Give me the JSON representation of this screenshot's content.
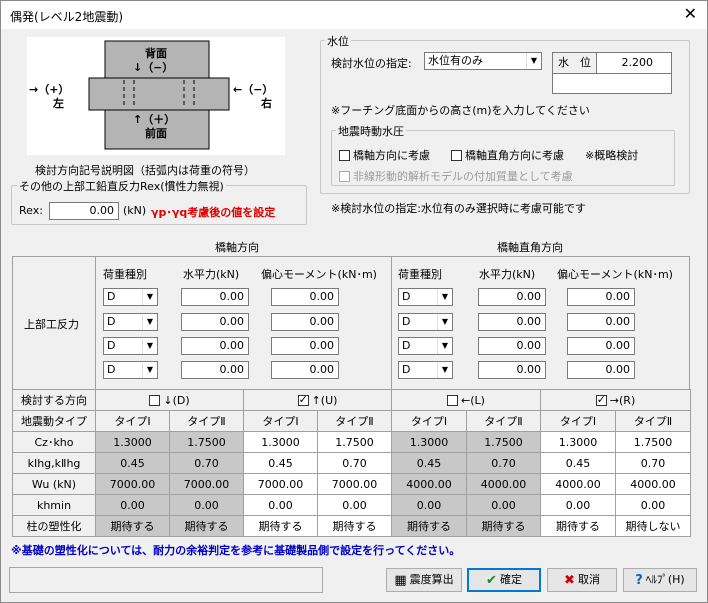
{
  "window": {
    "title": "偶発(レベル2地震動)",
    "close": "✕"
  },
  "diagram": {
    "back_label": "背面",
    "back_sign": "↓（−）",
    "front_label": "前面",
    "front_sign": "↑（＋）",
    "left_sign": "→（+）",
    "left_label": "左",
    "right_sign": "←（−）",
    "right_label": "右",
    "caption": "検討方向記号説明図（括弧内は荷重の符号）"
  },
  "other_reaction": {
    "legend": "その他の上部工鉛直反力Rex(慣性力無視)",
    "label": "Rex:",
    "value": "0.00",
    "unit": "(kN)",
    "note": "γp･γq考慮後の値を設定"
  },
  "water": {
    "legend": "水位",
    "spec_label": "検討水位の指定:",
    "spec_value": "水位有のみ",
    "level_label": "水　位",
    "level_value": "2.200",
    "hint": "※フーチング底面からの高さ(m)を入力してください",
    "pressure": {
      "legend": "地震時動水圧",
      "axis_bridge": "橋軸方向に考慮",
      "axis_perp": "橋軸直角方向に考慮",
      "approx": "※概略検討",
      "nonlinear": "非線形動的解析モデルの付加質量として考慮"
    },
    "footnote": "※検討水位の指定:水位有のみ選択時に考慮可能です"
  },
  "reaction": {
    "title_bridge": "橋軸方向",
    "title_perp": "橋軸直角方向",
    "row_label": "上部工反力",
    "col_type": "荷重種別",
    "col_h": "水平力(kN)",
    "col_m": "偏心モーメント(kN･m)",
    "bridge_rows": [
      {
        "type": "D",
        "h": "0.00",
        "m": "0.00"
      },
      {
        "type": "D",
        "h": "0.00",
        "m": "0.00"
      },
      {
        "type": "D",
        "h": "0.00",
        "m": "0.00"
      },
      {
        "type": "D",
        "h": "0.00",
        "m": "0.00"
      }
    ],
    "perp_rows": [
      {
        "type": "D",
        "h": "0.00",
        "m": "0.00"
      },
      {
        "type": "D",
        "h": "0.00",
        "m": "0.00"
      },
      {
        "type": "D",
        "h": "0.00",
        "m": "0.00"
      },
      {
        "type": "D",
        "h": "0.00",
        "m": "0.00"
      }
    ]
  },
  "directions": {
    "label": "検討する方向",
    "items": [
      {
        "label": "↓(D)",
        "checked": false
      },
      {
        "label": "↑(U)",
        "checked": true
      },
      {
        "label": "←(L)",
        "checked": false
      },
      {
        "label": "→(R)",
        "checked": true
      }
    ]
  },
  "params": {
    "type_label": "地震動タイプ",
    "types": [
      "タイプⅠ",
      "タイプⅡ",
      "タイプⅠ",
      "タイプⅡ",
      "タイプⅠ",
      "タイプⅡ",
      "タイプⅠ",
      "タイプⅡ"
    ],
    "rows": [
      {
        "label": "Cz･kho",
        "values": [
          "1.3000",
          "1.7500",
          "1.3000",
          "1.7500",
          "1.3000",
          "1.7500",
          "1.3000",
          "1.7500"
        ]
      },
      {
        "label": "kⅠhg,kⅡhg",
        "values": [
          "0.45",
          "0.70",
          "0.45",
          "0.70",
          "0.45",
          "0.70",
          "0.45",
          "0.70"
        ]
      },
      {
        "label": "Wu (kN)",
        "values": [
          "7000.00",
          "7000.00",
          "7000.00",
          "7000.00",
          "4000.00",
          "4000.00",
          "4000.00",
          "4000.00"
        ]
      },
      {
        "label": "khmin",
        "values": [
          "0.00",
          "0.00",
          "0.00",
          "0.00",
          "0.00",
          "0.00",
          "0.00",
          "0.00"
        ]
      }
    ],
    "plastic_label": "柱の塑性化",
    "plastic": [
      "期待する",
      "期待する",
      "期待する",
      "期待する",
      "期待する",
      "期待する",
      "期待する",
      "期待しない"
    ]
  },
  "note": "※基礎の塑性化については、耐力の余裕判定を参考に基礎製品側で設定を行ってください。",
  "buttons": {
    "seismic": "震度算出",
    "ok": "確定",
    "cancel": "取消",
    "help": "ﾍﾙﾌﾟ(H)"
  },
  "colors": {
    "accent": "#0078d7",
    "warning_red": "#e00000",
    "note_blue": "#0000c8",
    "disabled_cell": "#c8c8c8"
  }
}
